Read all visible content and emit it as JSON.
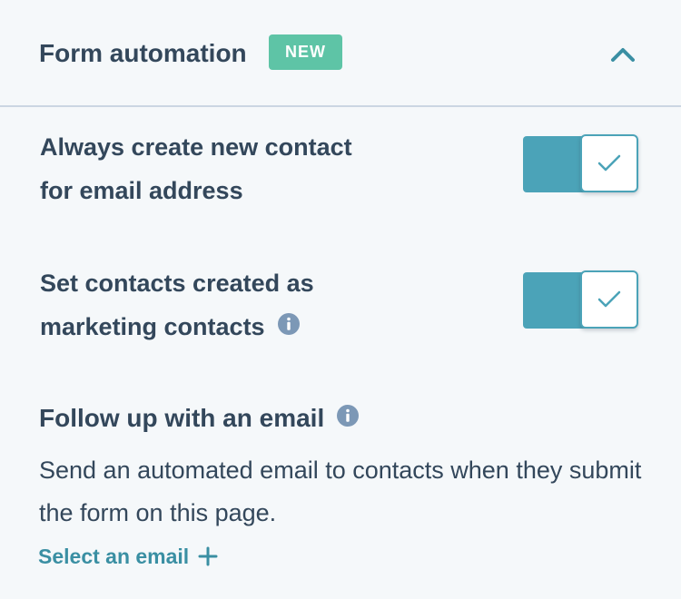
{
  "header": {
    "title": "Form automation",
    "badge": "NEW",
    "collapse_icon": "chevron-up-icon"
  },
  "settings": [
    {
      "label_lines": [
        "Always create new contact",
        "for email address"
      ],
      "enabled": true,
      "has_info": false
    },
    {
      "label_lines": [
        "Set contacts created as",
        "marketing contacts"
      ],
      "enabled": true,
      "has_info": true
    }
  ],
  "follow_up": {
    "title": "Follow up with an email",
    "description": "Send an automated email to contacts when they submit the form on this page.",
    "link_label": "Select an email",
    "link_icon": "plus-icon"
  },
  "colors": {
    "background": "#f5f8fa",
    "text": "#33475b",
    "badge": "#5ec4a6",
    "toggle": "#4ba3b8",
    "link": "#3a8fa3",
    "info_icon": "#7c98b6",
    "divider": "#cbd6e2"
  }
}
